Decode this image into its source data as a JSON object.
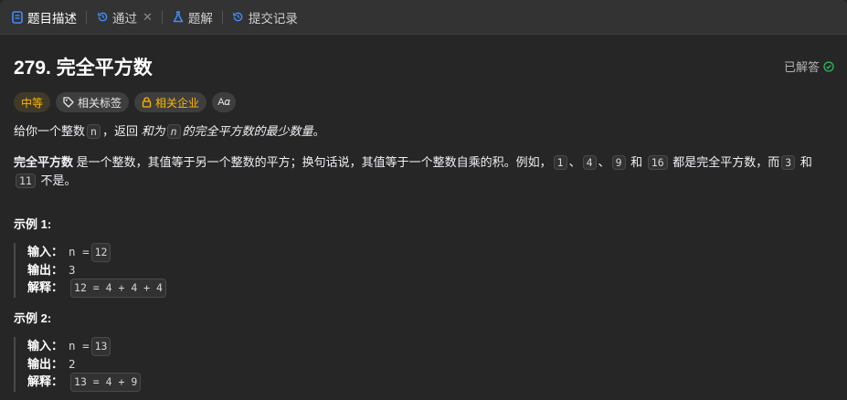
{
  "tabs": [
    {
      "label": "题目描述",
      "icon": "document-icon",
      "active": true
    },
    {
      "label": "通过",
      "icon": "history-icon",
      "closable": true
    },
    {
      "label": "题解",
      "icon": "flask-icon"
    },
    {
      "label": "提交记录",
      "icon": "history-icon"
    }
  ],
  "problem": {
    "title": "279. 完全平方数",
    "status": "已解答",
    "tags": {
      "difficulty": "中等",
      "related": "相关标签",
      "company": "相关企业"
    },
    "desc1": {
      "a": "给你一个整数",
      "n": "n",
      "b": "，返回",
      "c": "和为",
      "n2": "n",
      "d": "的完全平方数的最少数量",
      "e": "。"
    },
    "desc2": {
      "a": "完全平方数",
      "b": "是一个整数，其值等于另一个整数的平方；换句话说，其值等于一个整数自乘的积。例如，",
      "v1": "1",
      "sep1": "、",
      "v2": "4",
      "sep2": "、",
      "v3": "9",
      "c": "和",
      "v4": "16",
      "d": "都是完全平方数，而",
      "v5": "3",
      "e": "和",
      "v6": "11",
      "f": "不是。"
    }
  },
  "examples": [
    {
      "heading": "示例 1:",
      "input_label": "输入：",
      "input": "n = ",
      "input_val": "12",
      "output_label": "输出：",
      "output": "3",
      "explain_label": "解释：",
      "explain": "12 = 4 + 4 + 4"
    },
    {
      "heading": "示例 2:",
      "input_label": "输入：",
      "input": "n = ",
      "input_val": "13",
      "output_label": "输出：",
      "output": "2",
      "explain_label": "解释：",
      "explain": "13 = 4 + 9"
    }
  ]
}
